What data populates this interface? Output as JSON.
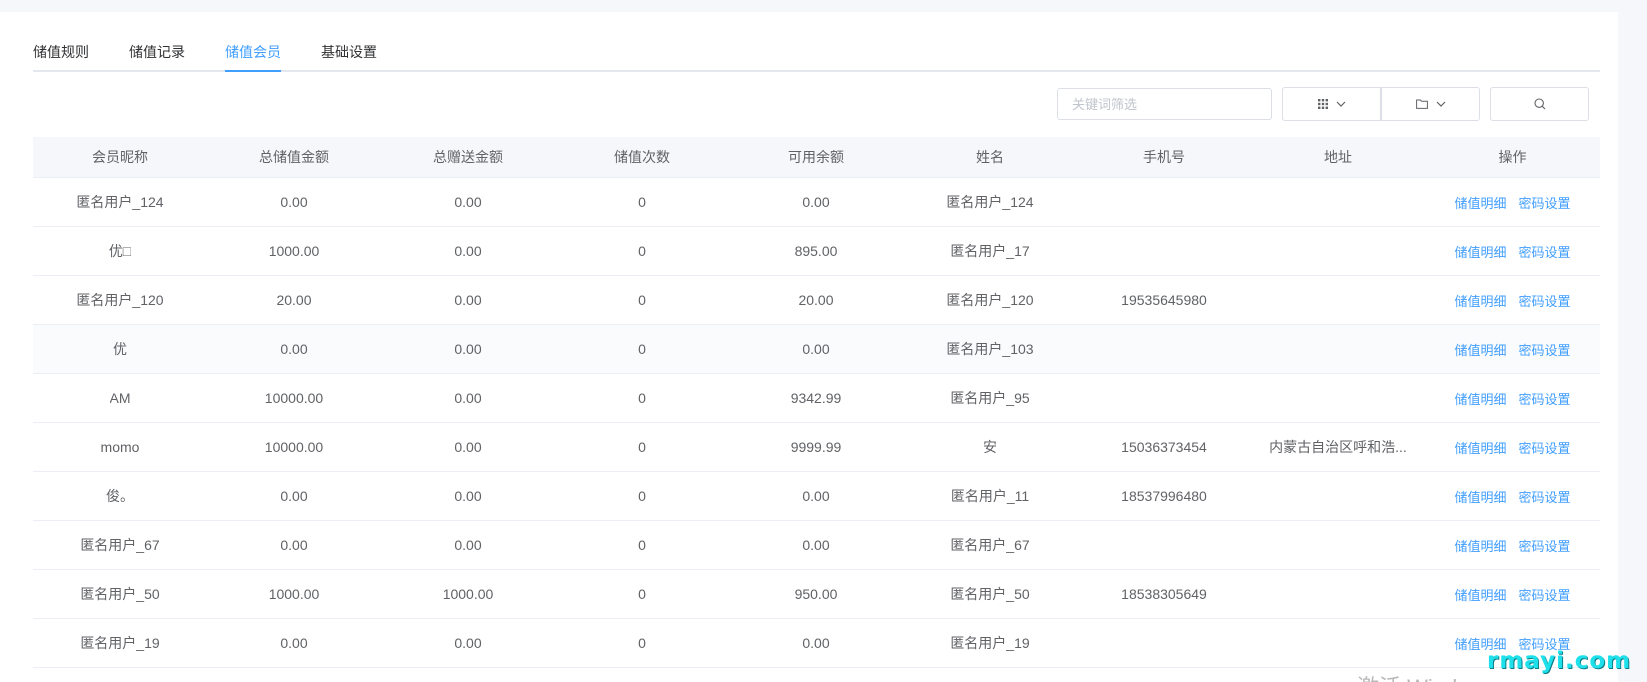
{
  "tabs": [
    {
      "label": "储值规则"
    },
    {
      "label": "储值记录"
    },
    {
      "label": "储值会员"
    },
    {
      "label": "基础设置"
    }
  ],
  "active_tab": 2,
  "accent_color": "#409eff",
  "toolbar": {
    "search_placeholder": "关键词筛选",
    "search_value": "",
    "grid_icon": "grid-icon",
    "folder_icon": "folder-icon",
    "search_icon": "search-icon"
  },
  "table": {
    "headers": [
      "会员昵称",
      "总储值金额",
      "总赠送金额",
      "储值次数",
      "可用余额",
      "姓名",
      "手机号",
      "地址",
      "操作"
    ],
    "rows": [
      {
        "nickname": "匿名用户_124",
        "total_recharge": "0.00",
        "total_gift": "0.00",
        "count": "0",
        "balance": "0.00",
        "name": "匿名用户_124",
        "phone": "",
        "address": ""
      },
      {
        "nickname": "优□",
        "total_recharge": "1000.00",
        "total_gift": "0.00",
        "count": "0",
        "balance": "895.00",
        "name": "匿名用户_17",
        "phone": "",
        "address": ""
      },
      {
        "nickname": "匿名用户_120",
        "total_recharge": "20.00",
        "total_gift": "0.00",
        "count": "0",
        "balance": "20.00",
        "name": "匿名用户_120",
        "phone": "19535645980",
        "address": ""
      },
      {
        "nickname": "优",
        "total_recharge": "0.00",
        "total_gift": "0.00",
        "count": "0",
        "balance": "0.00",
        "name": "匿名用户_103",
        "phone": "",
        "address": ""
      },
      {
        "nickname": "AM",
        "total_recharge": "10000.00",
        "total_gift": "0.00",
        "count": "0",
        "balance": "9342.99",
        "name": "匿名用户_95",
        "phone": "",
        "address": ""
      },
      {
        "nickname": "momo",
        "total_recharge": "10000.00",
        "total_gift": "0.00",
        "count": "0",
        "balance": "9999.99",
        "name": "安",
        "phone": "15036373454",
        "address": "内蒙古自治区呼和浩..."
      },
      {
        "nickname": "俊。",
        "total_recharge": "0.00",
        "total_gift": "0.00",
        "count": "0",
        "balance": "0.00",
        "name": "匿名用户_11",
        "phone": "18537996480",
        "address": ""
      },
      {
        "nickname": "匿名用户_67",
        "total_recharge": "0.00",
        "total_gift": "0.00",
        "count": "0",
        "balance": "0.00",
        "name": "匿名用户_67",
        "phone": "",
        "address": ""
      },
      {
        "nickname": "匿名用户_50",
        "total_recharge": "1000.00",
        "total_gift": "1000.00",
        "count": "0",
        "balance": "950.00",
        "name": "匿名用户_50",
        "phone": "18538305649",
        "address": ""
      },
      {
        "nickname": "匿名用户_19",
        "total_recharge": "0.00",
        "total_gift": "0.00",
        "count": "0",
        "balance": "0.00",
        "name": "匿名用户_19",
        "phone": "",
        "address": ""
      }
    ],
    "actions": {
      "detail_label": "储值明细",
      "password_label": "密码设置"
    }
  },
  "watermark": "rmayi.com",
  "activation_text": "激活 Windows"
}
